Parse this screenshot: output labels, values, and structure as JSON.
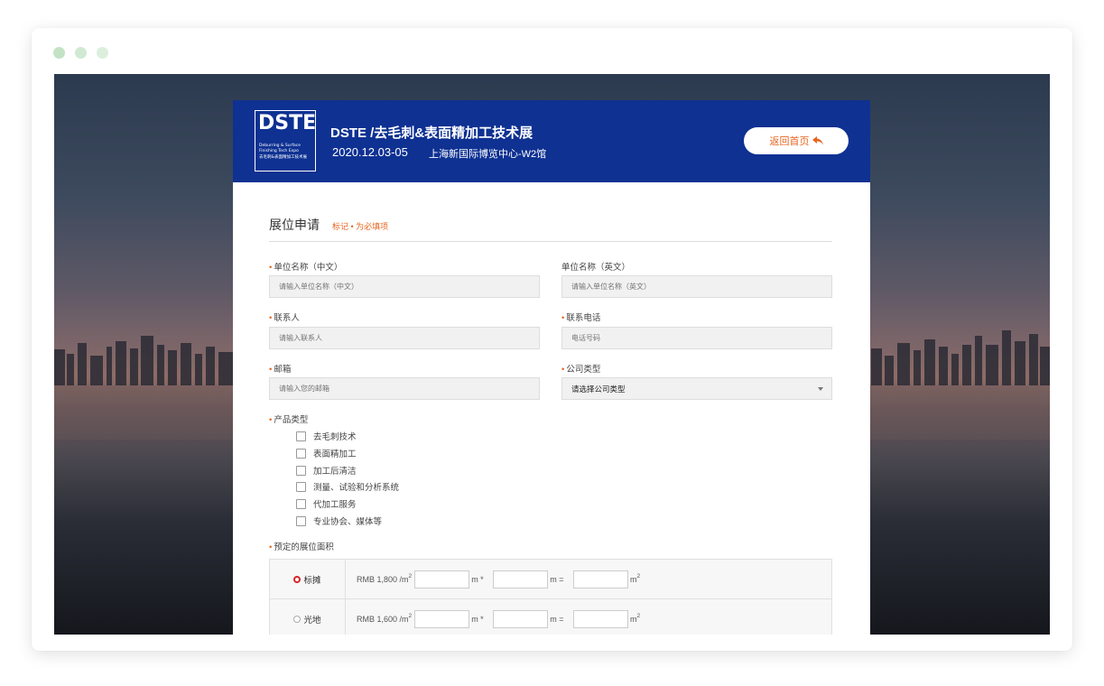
{
  "window": {
    "dots": [
      "#c4e2c6",
      "#d1e9d2",
      "#dcefdc"
    ]
  },
  "header": {
    "logo": {
      "main": "DSTE",
      "sub_lines": [
        "Deburring & Surface",
        "Finishing Tech Expo",
        "去毛刺&表面精加工技术展"
      ]
    },
    "title": "DSTE /去毛刺&表面精加工技术展",
    "date": "2020.12.03-05",
    "venue": "上海新国际博览中心-W2馆",
    "home_button": "返回首页",
    "home_icon": "reply-arrow-icon",
    "bg_color": "#0e3192"
  },
  "form": {
    "title": "展位申请",
    "note": "标记 • 为必填项",
    "accent_color": "#e8641e",
    "required_mark": "•",
    "fields": {
      "company_cn": {
        "label": "单位名称（中文）",
        "required": true,
        "placeholder": "请输入单位名称（中文）"
      },
      "company_en": {
        "label": "单位名称（英文）",
        "required": false,
        "placeholder": "请输入单位名称（英文）"
      },
      "contact": {
        "label": "联系人",
        "required": true,
        "placeholder": "请输入联系人"
      },
      "phone": {
        "label": "联系电话",
        "required": true,
        "placeholder": "电话号码"
      },
      "email": {
        "label": "邮箱",
        "required": true,
        "placeholder": "请输入您的邮箱"
      },
      "company_type": {
        "label": "公司类型",
        "required": true,
        "selected": "请选择公司类型"
      }
    },
    "product_types": {
      "label": "产品类型",
      "options": [
        "去毛刺技术",
        "表面精加工",
        "加工后清洁",
        "测量、试验和分析系统",
        "代加工服务",
        "专业协会、媒体等"
      ]
    },
    "booth_area": {
      "label": "预定的展位面积",
      "rows": [
        {
          "type": "标摊",
          "selected": true,
          "price": "RMB 1,800 /m",
          "sup": "2",
          "times": "m *",
          "equals": "m =",
          "unit": "m"
        },
        {
          "type": "光地",
          "selected": false,
          "price": "RMB 1,600 /m",
          "sup": "2",
          "times": "m *",
          "equals": "m =",
          "unit": "m"
        }
      ]
    }
  }
}
